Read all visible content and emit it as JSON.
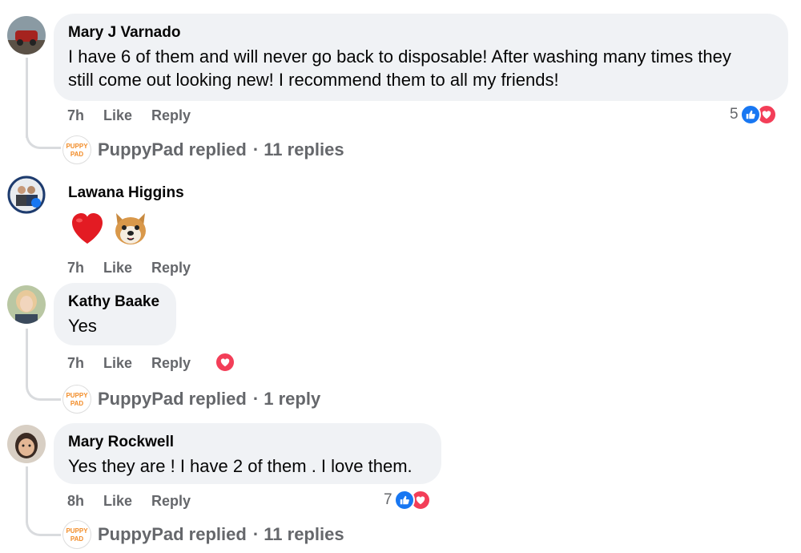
{
  "comments": [
    {
      "author": "Mary J Varnado",
      "text_line1": "I have 6 of them and will never go back to disposable! After washing many times they",
      "text_line2": "still come out looking new! I recommend them to all my friends!",
      "time": "7h",
      "like_label": "Like",
      "reply_label": "Reply",
      "reaction_count": "5",
      "reactions": [
        "like",
        "love"
      ],
      "replies": {
        "replier": "PuppyPad replied",
        "count": "· 11 replies"
      }
    },
    {
      "author": "Lawana Higgins",
      "emojis": [
        "red-heart",
        "dog-face"
      ],
      "time": "7h",
      "like_label": "Like",
      "reply_label": "Reply"
    },
    {
      "author": "Kathy Baake",
      "text": "Yes",
      "time": "7h",
      "like_label": "Like",
      "reply_label": "Reply",
      "reactions": [
        "love"
      ],
      "replies": {
        "replier": "PuppyPad replied",
        "count": "· 1 reply"
      }
    },
    {
      "author": "Mary Rockwell",
      "text": "Yes they are ! I have 2 of them . I love them.",
      "time": "8h",
      "like_label": "Like",
      "reply_label": "Reply",
      "reaction_count": "7",
      "reactions": [
        "like",
        "love"
      ],
      "replies": {
        "replier": "PuppyPad replied",
        "count": "· 11 replies"
      }
    }
  ],
  "colors": {
    "bubble": "#f0f2f5",
    "meta_text": "#65676b",
    "like_blue": "#1877f2",
    "love_red": "#f33e58",
    "thread_line": "#d9dbde"
  },
  "logo_text": "PUPPY PAD"
}
